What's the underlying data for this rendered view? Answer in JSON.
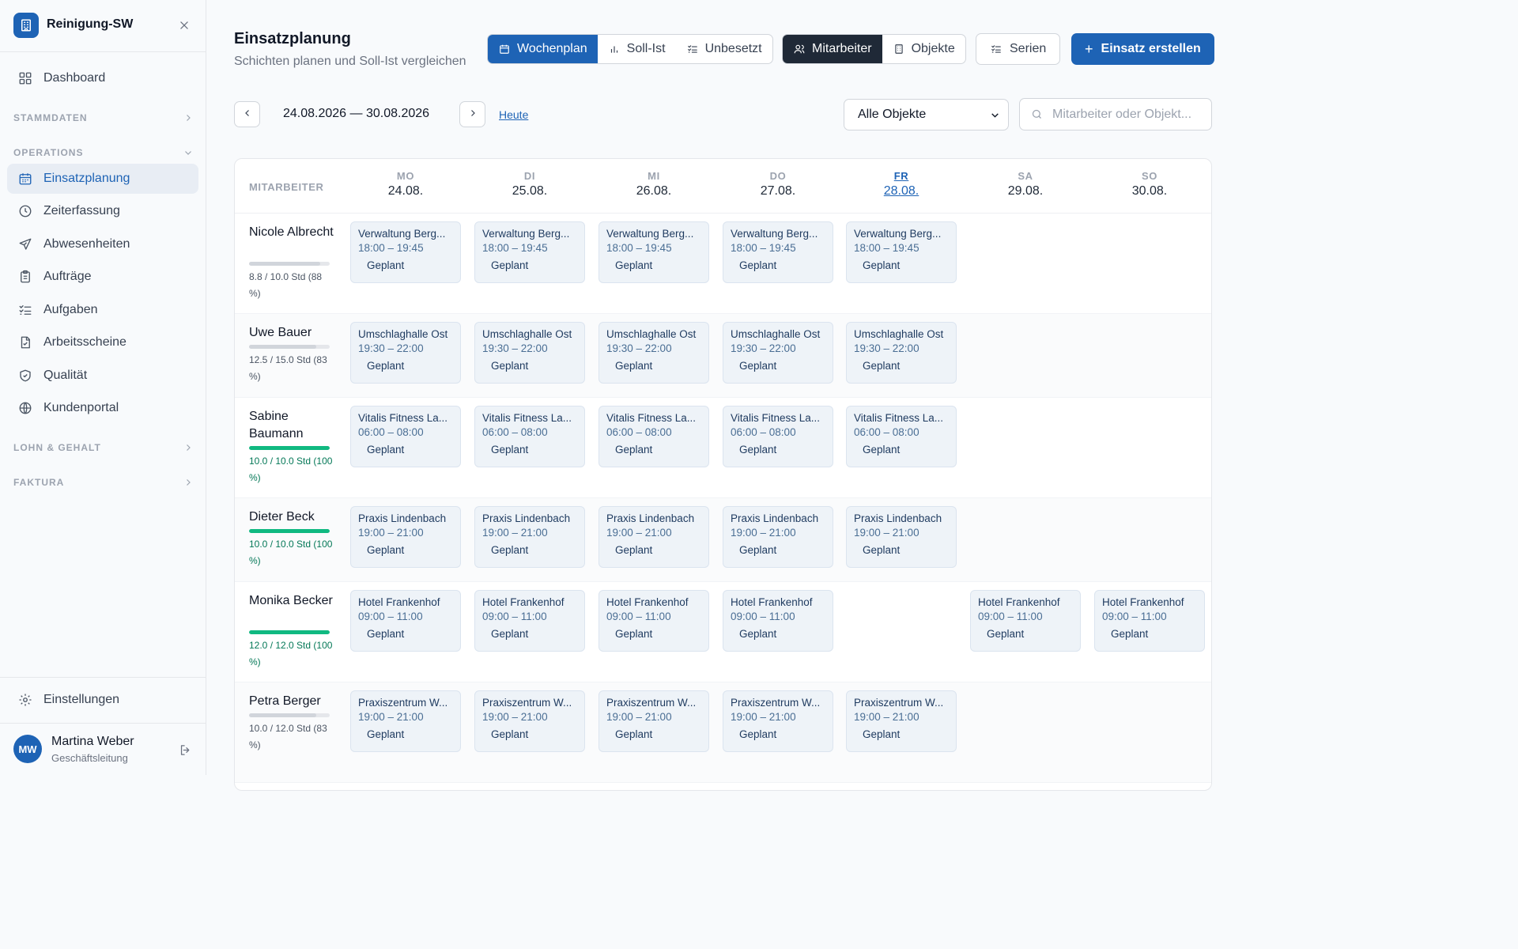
{
  "sidebar": {
    "brand": "Reinigung-SW",
    "dashboard": "Dashboard",
    "section_stammdaten": "STAMMDATEN",
    "section_operations": "OPERATIONS",
    "items": [
      {
        "label": "Einsatzplanung",
        "icon": "calendar-icon"
      },
      {
        "label": "Zeiterfassung",
        "icon": "clock-icon"
      },
      {
        "label": "Abwesenheiten",
        "icon": "plane-icon"
      },
      {
        "label": "Aufträge",
        "icon": "clipboard-icon"
      },
      {
        "label": "Aufgaben",
        "icon": "checklist-icon"
      },
      {
        "label": "Arbeitsscheine",
        "icon": "document-icon"
      },
      {
        "label": "Qualität",
        "icon": "shield-icon"
      },
      {
        "label": "Kundenportal",
        "icon": "globe-icon"
      }
    ],
    "section_lohn": "LOHN & GEHALT",
    "section_faktura": "FAKTURA",
    "settings": "Einstellungen",
    "user": {
      "initials": "MW",
      "name": "Martina Weber",
      "role": "Geschäftsleitung"
    }
  },
  "header": {
    "title": "Einsatzplanung",
    "subtitle": "Schichten planen und Soll-Ist vergleichen",
    "view_tabs": [
      "Wochenplan",
      "Soll-Ist",
      "Unbesetzt"
    ],
    "group_tabs": [
      "Mitarbeiter",
      "Objekte"
    ],
    "series_label": "Serien",
    "create_label": "Einsatz erstellen"
  },
  "toolbar": {
    "date_range": "24.08.2026 — 30.08.2026",
    "today_label": "Heute",
    "object_filter": "Alle Objekte",
    "search_placeholder": "Mitarbeiter oder Objekt..."
  },
  "grid": {
    "employee_header": "MITARBEITER",
    "days": [
      {
        "name": "MO",
        "date": "24.08."
      },
      {
        "name": "DI",
        "date": "25.08."
      },
      {
        "name": "MI",
        "date": "26.08."
      },
      {
        "name": "DO",
        "date": "27.08."
      },
      {
        "name": "FR",
        "date": "28.08.",
        "today": true
      },
      {
        "name": "SA",
        "date": "29.08."
      },
      {
        "name": "SO",
        "date": "30.08."
      }
    ],
    "employees": [
      {
        "name": "Nicole Albrecht",
        "hours": "8.8 / 10.0 Std (88 %)",
        "utilization": 0.88,
        "shifts": [
          {
            "day": 0,
            "object": "Verwaltung Berg...",
            "time": "18:00 – 19:45",
            "status": "Geplant"
          },
          {
            "day": 1,
            "object": "Verwaltung Berg...",
            "time": "18:00 – 19:45",
            "status": "Geplant"
          },
          {
            "day": 2,
            "object": "Verwaltung Berg...",
            "time": "18:00 – 19:45",
            "status": "Geplant"
          },
          {
            "day": 3,
            "object": "Verwaltung Berg...",
            "time": "18:00 – 19:45",
            "status": "Geplant"
          },
          {
            "day": 4,
            "object": "Verwaltung Berg...",
            "time": "18:00 – 19:45",
            "status": "Geplant"
          }
        ]
      },
      {
        "name": "Uwe Bauer",
        "hours": "12.5 / 15.0 Std (83 %)",
        "utilization": 0.83,
        "shifts": [
          {
            "day": 0,
            "object": "Umschlaghalle Ost",
            "time": "19:30 – 22:00",
            "status": "Geplant"
          },
          {
            "day": 1,
            "object": "Umschlaghalle Ost",
            "time": "19:30 – 22:00",
            "status": "Geplant"
          },
          {
            "day": 2,
            "object": "Umschlaghalle Ost",
            "time": "19:30 – 22:00",
            "status": "Geplant"
          },
          {
            "day": 3,
            "object": "Umschlaghalle Ost",
            "time": "19:30 – 22:00",
            "status": "Geplant"
          },
          {
            "day": 4,
            "object": "Umschlaghalle Ost",
            "time": "19:30 – 22:00",
            "status": "Geplant"
          }
        ]
      },
      {
        "name": "Sabine Baumann",
        "hours": "10.0 / 10.0 Std (100 %)",
        "utilization": 1.0,
        "shifts": [
          {
            "day": 0,
            "object": "Vitalis Fitness La...",
            "time": "06:00 – 08:00",
            "status": "Geplant"
          },
          {
            "day": 1,
            "object": "Vitalis Fitness La...",
            "time": "06:00 – 08:00",
            "status": "Geplant"
          },
          {
            "day": 2,
            "object": "Vitalis Fitness La...",
            "time": "06:00 – 08:00",
            "status": "Geplant"
          },
          {
            "day": 3,
            "object": "Vitalis Fitness La...",
            "time": "06:00 – 08:00",
            "status": "Geplant"
          },
          {
            "day": 4,
            "object": "Vitalis Fitness La...",
            "time": "06:00 – 08:00",
            "status": "Geplant"
          }
        ]
      },
      {
        "name": "Dieter Beck",
        "hours": "10.0 / 10.0 Std (100 %)",
        "utilization": 1.0,
        "shifts": [
          {
            "day": 0,
            "object": "Praxis Lindenbach",
            "time": "19:00 – 21:00",
            "status": "Geplant"
          },
          {
            "day": 1,
            "object": "Praxis Lindenbach",
            "time": "19:00 – 21:00",
            "status": "Geplant"
          },
          {
            "day": 2,
            "object": "Praxis Lindenbach",
            "time": "19:00 – 21:00",
            "status": "Geplant"
          },
          {
            "day": 3,
            "object": "Praxis Lindenbach",
            "time": "19:00 – 21:00",
            "status": "Geplant"
          },
          {
            "day": 4,
            "object": "Praxis Lindenbach",
            "time": "19:00 – 21:00",
            "status": "Geplant"
          }
        ]
      },
      {
        "name": "Monika Becker",
        "hours": "12.0 / 12.0 Std (100 %)",
        "utilization": 1.0,
        "shifts": [
          {
            "day": 0,
            "object": "Hotel Frankenhof",
            "time": "09:00 – 11:00",
            "status": "Geplant"
          },
          {
            "day": 1,
            "object": "Hotel Frankenhof",
            "time": "09:00 – 11:00",
            "status": "Geplant"
          },
          {
            "day": 2,
            "object": "Hotel Frankenhof",
            "time": "09:00 – 11:00",
            "status": "Geplant"
          },
          {
            "day": 3,
            "object": "Hotel Frankenhof",
            "time": "09:00 – 11:00",
            "status": "Geplant"
          },
          {
            "day": 5,
            "object": "Hotel Frankenhof",
            "time": "09:00 – 11:00",
            "status": "Geplant"
          },
          {
            "day": 6,
            "object": "Hotel Frankenhof",
            "time": "09:00 – 11:00",
            "status": "Geplant"
          }
        ]
      },
      {
        "name": "Petra Berger",
        "hours": "10.0 / 12.0 Std (83 %)",
        "utilization": 0.83,
        "shifts": [
          {
            "day": 0,
            "object": "Praxiszentrum W...",
            "time": "19:00 – 21:00",
            "status": "Geplant"
          },
          {
            "day": 1,
            "object": "Praxiszentrum W...",
            "time": "19:00 – 21:00",
            "status": "Geplant"
          },
          {
            "day": 2,
            "object": "Praxiszentrum W...",
            "time": "19:00 – 21:00",
            "status": "Geplant"
          },
          {
            "day": 3,
            "object": "Praxiszentrum W...",
            "time": "19:00 – 21:00",
            "status": "Geplant"
          },
          {
            "day": 4,
            "object": "Praxiszentrum W...",
            "time": "19:00 – 21:00",
            "status": "Geplant"
          }
        ]
      }
    ]
  },
  "colors": {
    "accent": "#1e63b5",
    "dark": "#1f2937",
    "ok": "#10b981"
  }
}
